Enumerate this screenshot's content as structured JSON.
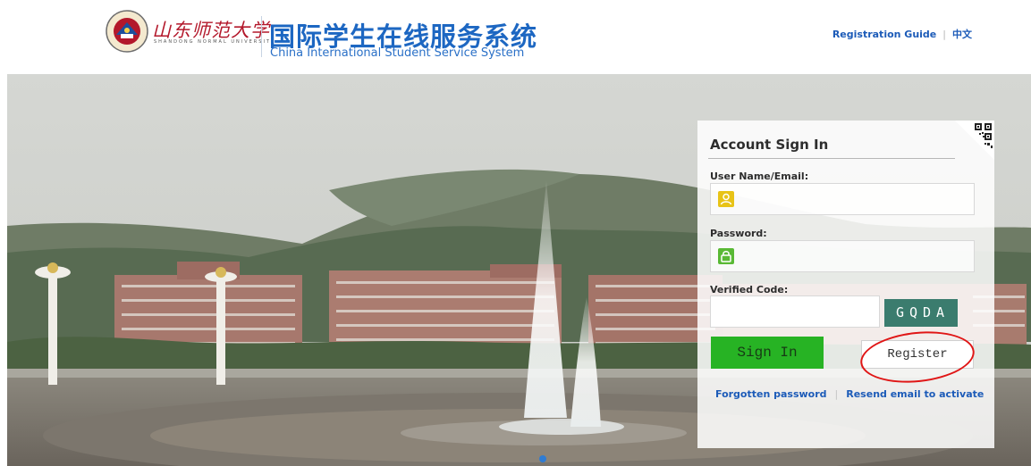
{
  "header": {
    "university_name": "山东师范大学",
    "university_name_en": "SHANDONG NORMAL UNIVERSITY",
    "system_title": "国际学生在线服务系统",
    "system_subtitle": "China International Student Service System",
    "registration_guide_link": "Registration Guide",
    "language_link": "中文"
  },
  "login": {
    "title": "Account Sign In",
    "username_label": "User Name/Email:",
    "password_label": "Password:",
    "verified_code_label": "Verified Code:",
    "captcha_text": "GQDA",
    "signin_label": "Sign In",
    "register_label": "Register",
    "forgotten_password_link": "Forgotten password",
    "resend_email_link": "Resend email to activate"
  },
  "colors": {
    "brand_blue": "#1d67c2",
    "university_red": "#b3182b",
    "signin_green": "#27b324",
    "username_icon": "#e8c317",
    "password_icon": "#59b935",
    "annotation_red": "#e01616"
  },
  "icons": {
    "username": "user-icon",
    "password": "lock-icon",
    "qr": "qr-code-icon",
    "logo": "university-emblem-icon"
  },
  "carousel": {
    "active_slide": 1
  }
}
